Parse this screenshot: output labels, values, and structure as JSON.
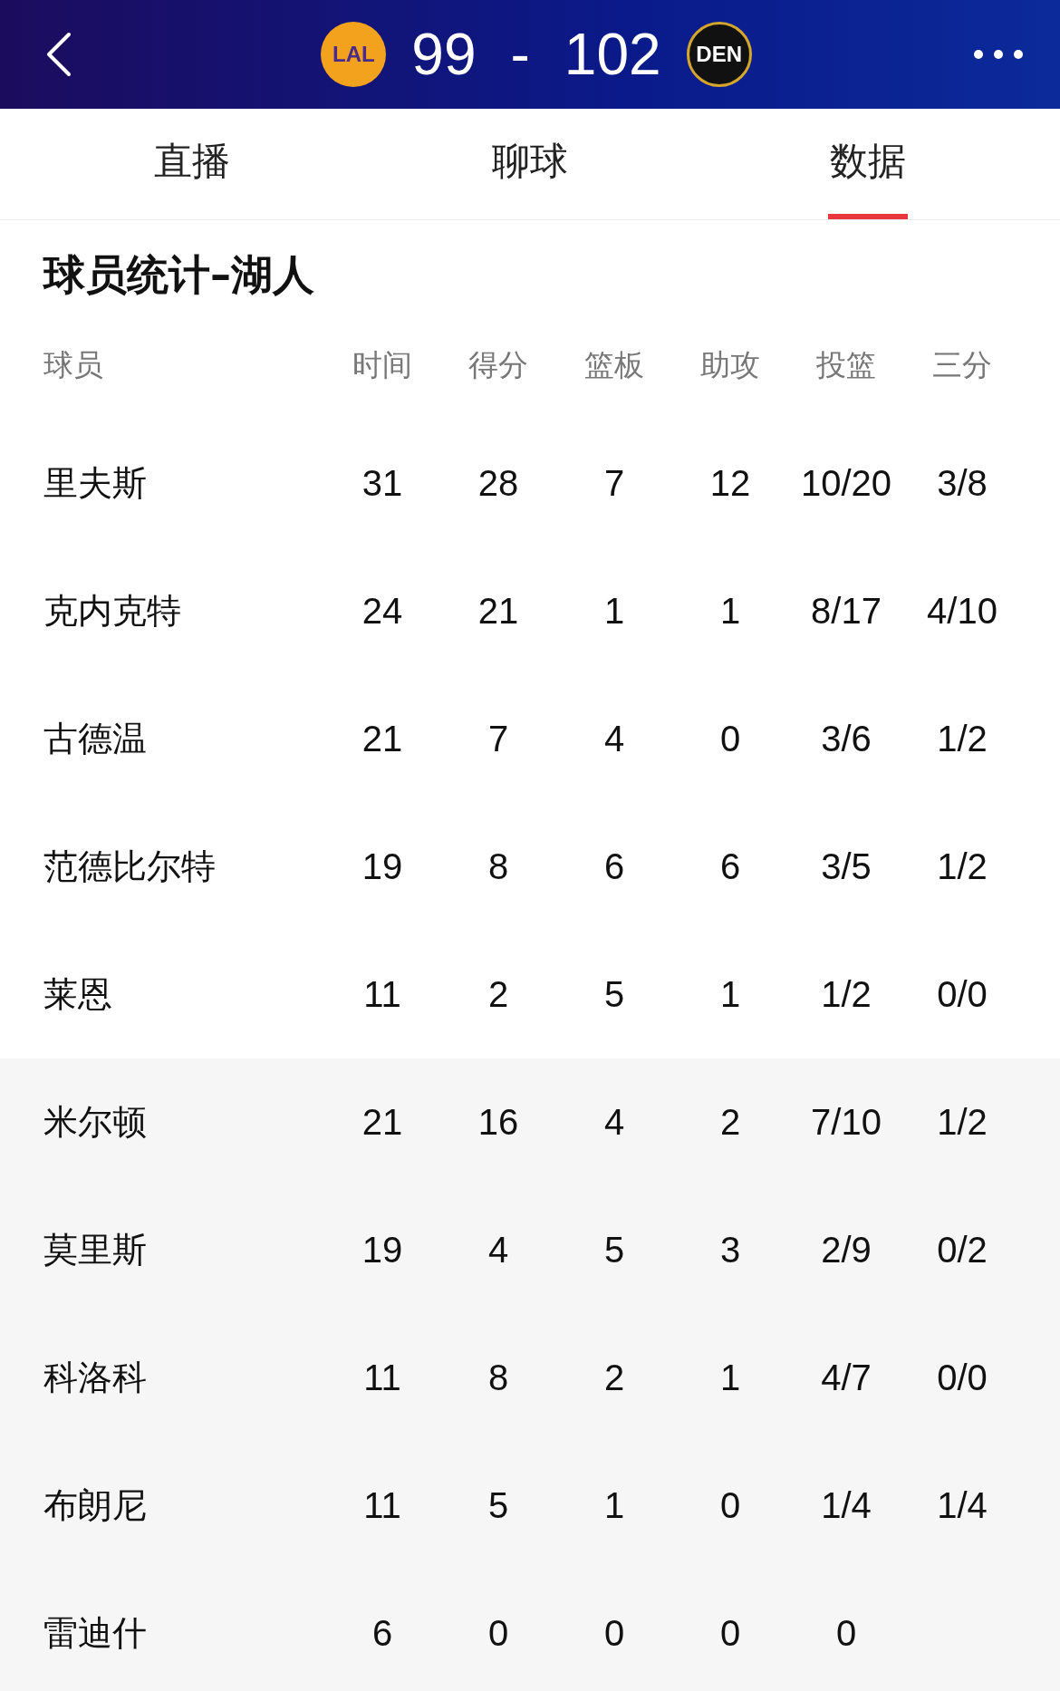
{
  "header": {
    "home_team": "LAL",
    "home_score": "99",
    "separator": "-",
    "away_score": "102",
    "away_team": "DEN"
  },
  "tabs": [
    {
      "label": "直播",
      "selected": false
    },
    {
      "label": "聊球",
      "selected": false
    },
    {
      "label": "数据",
      "selected": true
    }
  ],
  "section_title": "球员统计–湖人",
  "table": {
    "columns": [
      "球员",
      "时间",
      "得分",
      "篮板",
      "助攻",
      "投篮",
      "三分"
    ],
    "starters": [
      [
        "里夫斯",
        "31",
        "28",
        "7",
        "12",
        "10/20",
        "3/8"
      ],
      [
        "克内克特",
        "24",
        "21",
        "1",
        "1",
        "8/17",
        "4/10"
      ],
      [
        "古德温",
        "21",
        "7",
        "4",
        "0",
        "3/6",
        "1/2"
      ],
      [
        "范德比尔特",
        "19",
        "8",
        "6",
        "6",
        "3/5",
        "1/2"
      ],
      [
        "莱恩",
        "11",
        "2",
        "5",
        "1",
        "1/2",
        "0/0"
      ]
    ],
    "bench": [
      [
        "米尔顿",
        "21",
        "16",
        "4",
        "2",
        "7/10",
        "1/2"
      ],
      [
        "莫里斯",
        "19",
        "4",
        "5",
        "3",
        "2/9",
        "0/2"
      ],
      [
        "科洛科",
        "11",
        "8",
        "2",
        "1",
        "4/7",
        "0/0"
      ],
      [
        "布朗尼",
        "11",
        "5",
        "1",
        "0",
        "1/4",
        "1/4"
      ],
      [
        "雷迪什",
        "6",
        "0",
        "0",
        "0",
        "0"
      ]
    ]
  }
}
